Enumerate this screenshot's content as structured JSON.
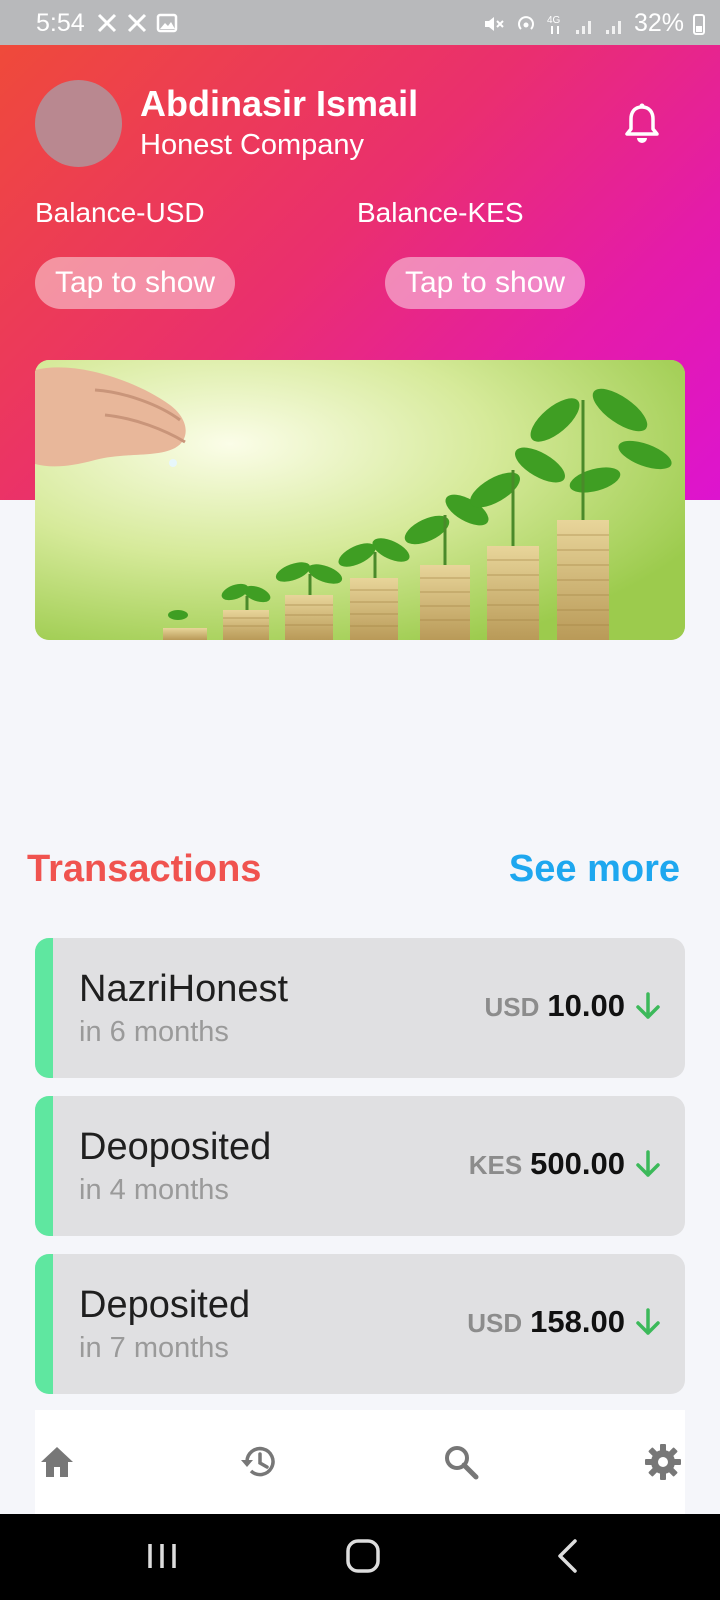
{
  "status_bar": {
    "time": "5:54",
    "left_icons": [
      "x-icon",
      "x-icon",
      "image-icon"
    ],
    "right_icons": [
      "mute-icon",
      "hotspot-icon",
      "4g-icon",
      "signal-icon",
      "signal-icon"
    ],
    "battery": "32%"
  },
  "header": {
    "user_name": "Abdinasir Ismail",
    "company": "Honest Company",
    "balance_usd_label": "Balance-USD",
    "balance_kes_label": "Balance-KES",
    "tap_to_show_usd": "Tap to show",
    "tap_to_show_kes": "Tap to show"
  },
  "transactions": {
    "title": "Transactions",
    "see_more": "See more",
    "items": [
      {
        "name": "NazriHonest",
        "time": "in 6 months",
        "currency": "USD",
        "amount": "10.00"
      },
      {
        "name": "Deoposited",
        "time": "in 4 months",
        "currency": "KES",
        "amount": "500.00"
      },
      {
        "name": "Deposited",
        "time": "in 7 months",
        "currency": "USD",
        "amount": "158.00"
      }
    ]
  },
  "bottom_nav": [
    "home-icon",
    "history-icon",
    "search-icon",
    "settings-icon"
  ],
  "colors": {
    "header_gradient_start": "#ef4a3a",
    "header_gradient_end": "#dd14cf",
    "transactions_title": "#f0534f",
    "see_more": "#1ea7ef",
    "card_accent": "#5fe7a0",
    "arrow_green": "#3cb95a"
  }
}
